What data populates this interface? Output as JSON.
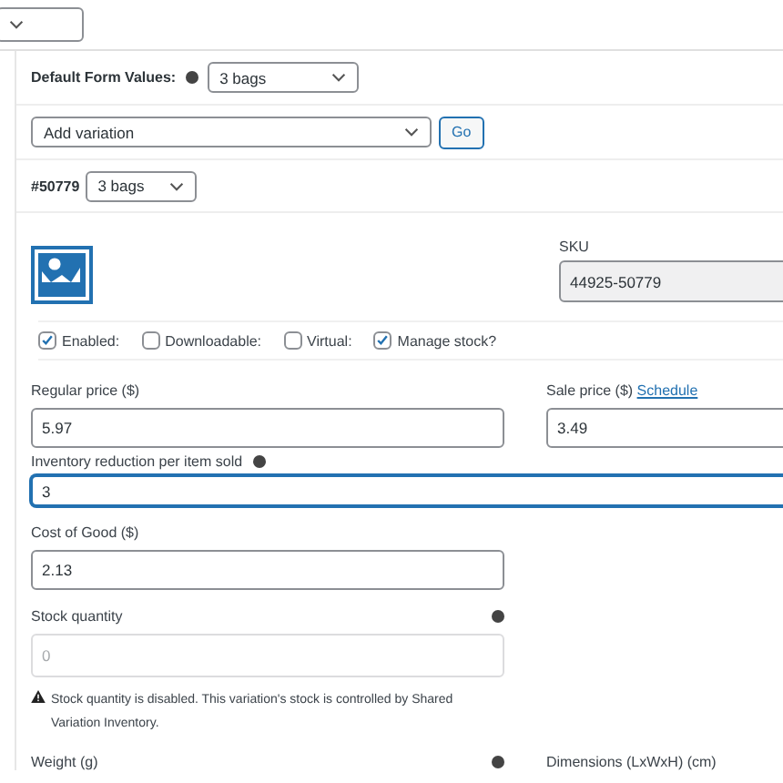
{
  "default_form_values": {
    "label": "Default Form Values:",
    "value": "3 bags"
  },
  "bulk_action": {
    "value": "Add variation",
    "button": "Go"
  },
  "variation": {
    "id": "#50779",
    "value": "3 bags",
    "sku": {
      "label": "SKU",
      "value": "44925-50779"
    },
    "options": [
      {
        "label": "Enabled:",
        "checked": true
      },
      {
        "label": "Downloadable:",
        "checked": false
      },
      {
        "label": "Virtual:",
        "checked": false
      },
      {
        "label": "Manage stock?",
        "checked": true
      }
    ],
    "regular_price": {
      "label": "Regular price ($)",
      "value": "5.97"
    },
    "sale_price": {
      "label": "Sale price ($)",
      "link": "Schedule",
      "value": "3.49"
    },
    "inventory_reduction": {
      "label": "Inventory reduction per item sold",
      "value": "3",
      "focused": true
    },
    "cost_of_good": {
      "label": "Cost of Good ($)",
      "value": "2.13"
    },
    "stock_quantity": {
      "label": "Stock quantity",
      "placeholder": "0",
      "disabled": true
    },
    "stock_notice": "Stock quantity is disabled. This variation's stock is controlled by Shared Variation Inventory.",
    "weight": {
      "label": "Weight (g)"
    },
    "dimensions": {
      "label": "Dimensions (LxWxH) (cm)"
    }
  }
}
